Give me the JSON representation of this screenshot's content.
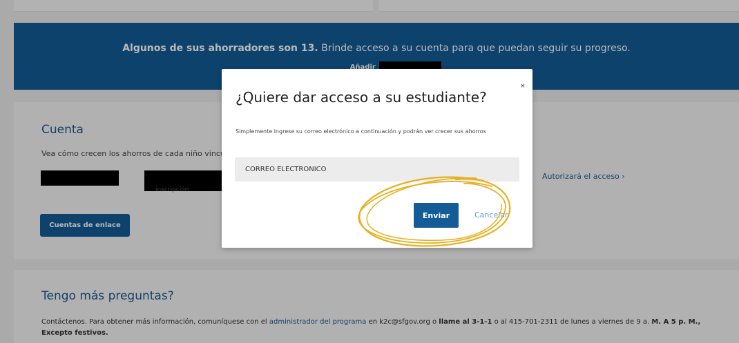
{
  "banner": {
    "bold_text": "Algunos de sus ahorradores son 13.",
    "text": " Brinde acceso a su cuenta para que puedan seguir su progreso.",
    "add_label": "Añadir"
  },
  "account": {
    "title": "Cuenta",
    "description": "Vea cómo crecen los ahorros de cada niño vincul",
    "partial_label": "inscripción",
    "authorize_link": "Autorizará el acceso",
    "link_accounts_button": "Cuentas de enlace"
  },
  "faq": {
    "title": "Tengo más preguntas?",
    "text_1": "Contáctenos. Para obtener más información, comuníquese con el ",
    "admin_link": "administrador del programa",
    "text_2": " en k2c@sfgov.org o ",
    "bold_call": "llame al 3-1-1",
    "text_3": " o al 415-701-2311 de lunes a viernes de 9 a. ",
    "bold_hours": "M. A 5 p. M., Excepto festivos."
  },
  "modal": {
    "close": "×",
    "title": "¿Quiere dar acceso a su estudiante?",
    "subtitle": "Simplemente ingrese su correo electrónico a continuación y podrán ver crecer sus ahorros",
    "email_placeholder": "CORREO ELECTRÓNICO",
    "send_button": "Enviar",
    "cancel_link": "Cancelar"
  },
  "colors": {
    "primary": "#135c97",
    "link": "#1b5a92",
    "annotation": "#e8b020"
  }
}
